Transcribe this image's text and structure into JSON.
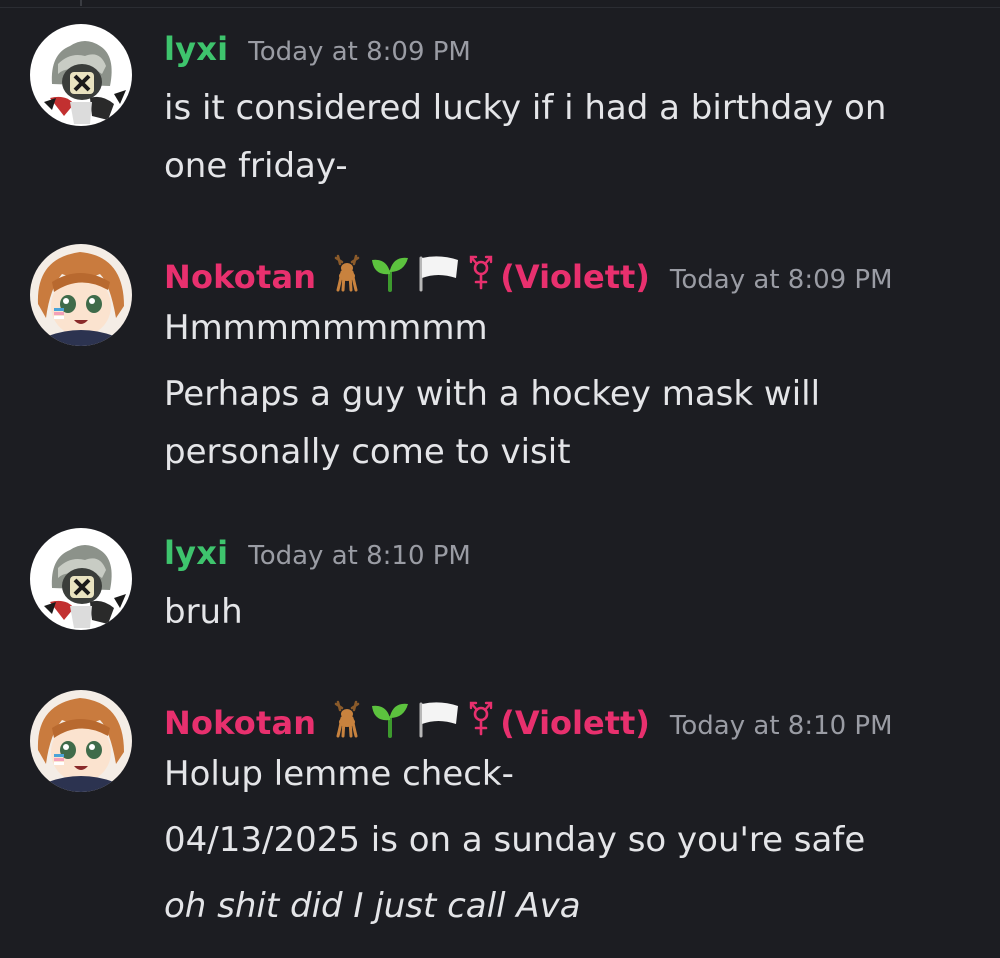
{
  "colors": {
    "background": "#1c1d22",
    "lyxi_name": "#3ec46d",
    "nokotan_name": "#e8306e",
    "text": "#e4e5e8",
    "timestamp": "#9a9ca4"
  },
  "messages": [
    {
      "username": "lyxi",
      "timestamp": "Today at 8:09 PM",
      "lines": [
        "is it considered lucky if i had a birthday on",
        "one friday-"
      ]
    },
    {
      "username": "Nokotan",
      "badges": [
        "deer-emoji",
        "seedling-emoji",
        "white-flag-emoji",
        "transgender-symbol"
      ],
      "nick_suffix": "(Violett)",
      "timestamp": "Today at 8:09 PM",
      "lines": [
        "Hmmmmmmmmm",
        "Perhaps a guy with a hockey mask will",
        "personally come to visit"
      ]
    },
    {
      "username": "lyxi",
      "timestamp": "Today at 8:10 PM",
      "lines": [
        "bruh"
      ]
    },
    {
      "username": "Nokotan",
      "badges": [
        "deer-emoji",
        "seedling-emoji",
        "white-flag-emoji",
        "transgender-symbol"
      ],
      "nick_suffix": "(Violett)",
      "timestamp": "Today at 8:10 PM",
      "lines": [
        "Holup lemme check-",
        "04/13/2025 is on a sunday so you're safe",
        "oh shit did I just call Ava"
      ]
    }
  ]
}
